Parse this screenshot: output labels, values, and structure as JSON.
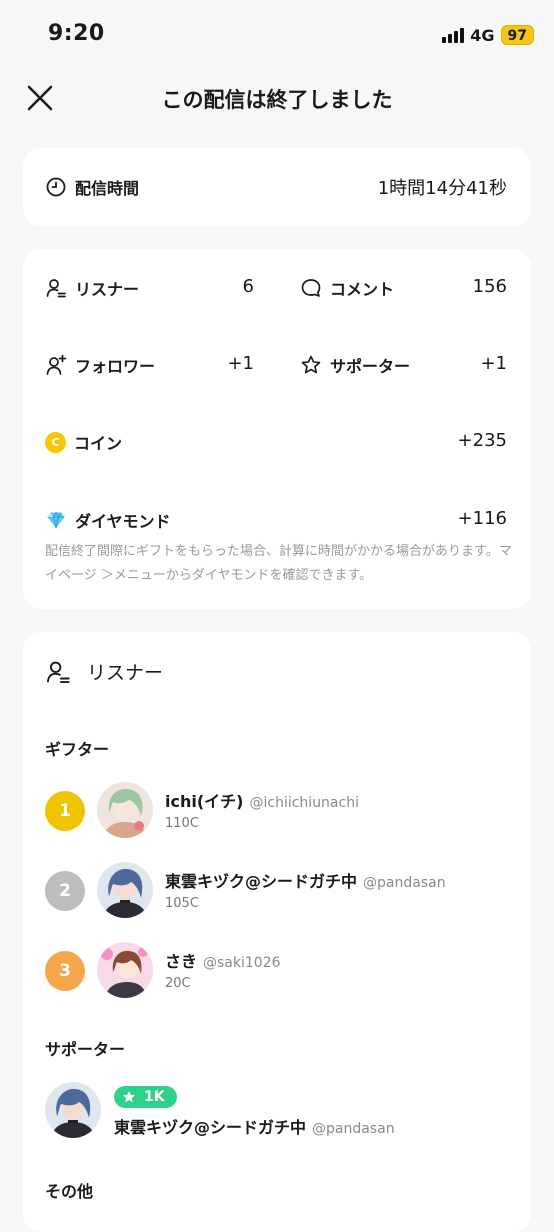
{
  "status": {
    "time": "9:20",
    "network": "4G",
    "battery": "97"
  },
  "header": {
    "title": "この配信は終了しました"
  },
  "duration": {
    "label": "配信時間",
    "value": "1時間14分41秒"
  },
  "stats": {
    "listeners": {
      "label": "リスナー",
      "value": "6"
    },
    "comments": {
      "label": "コメント",
      "value": "156"
    },
    "followers": {
      "label": "フォロワー",
      "value": "+1"
    },
    "supporters": {
      "label": "サポーター",
      "value": "+1"
    },
    "coins": {
      "label": "コイン",
      "value": "+235",
      "icon_letter": "C"
    },
    "diamonds": {
      "label": "ダイヤモンド",
      "value": "+116"
    },
    "note": "配信終了間際にギフトをもらった場合、計算に時間がかかる場合があります。マイページ ＞メニューからダイヤモンドを確認できます。"
  },
  "listeners_section": {
    "title": "リスナー",
    "gifters_heading": "ギフター",
    "gifters": [
      {
        "rank": "1",
        "name": "ichi(イチ)",
        "handle": "@ichiichiunachi",
        "coins": "110C",
        "rank_color": "#f0c400"
      },
      {
        "rank": "2",
        "name": "東雲キヅク@シードガチ中",
        "handle": "@pandasan",
        "coins": "105C",
        "rank_color": "#bdbdbd"
      },
      {
        "rank": "3",
        "name": "さき",
        "handle": "@saki1026",
        "coins": "20C",
        "rank_color": "#f5a54a"
      }
    ],
    "supporters_heading": "サポーター",
    "supporter": {
      "badge": "1K",
      "name": "東雲キヅク@シードガチ中",
      "handle": "@pandasan"
    },
    "other_heading": "その他"
  },
  "colors": {
    "accent": "#f5c518",
    "badge_green": "#2fd28c",
    "background": "#f7f7f7"
  }
}
